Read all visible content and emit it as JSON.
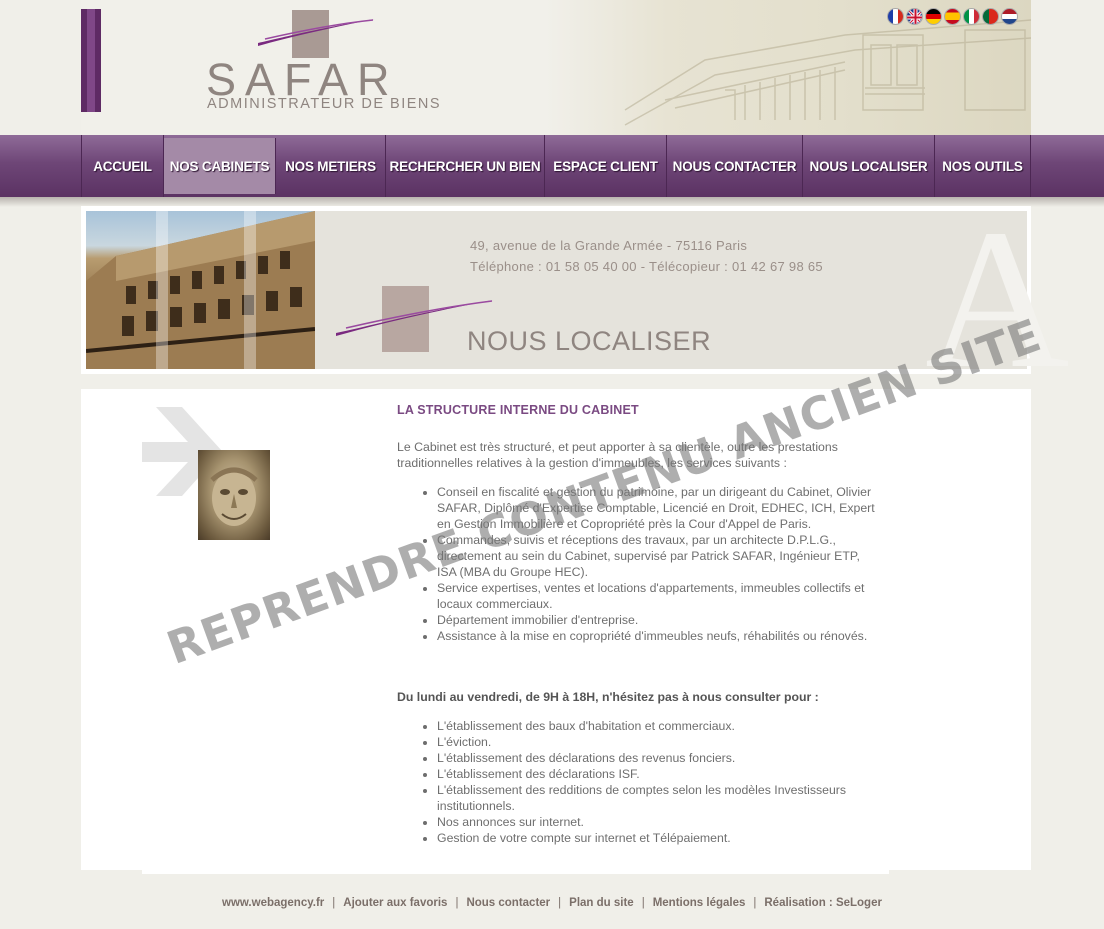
{
  "header": {
    "logo_text": "SAFAR",
    "logo_subtitle": "ADMINISTRATEUR DE BIENS",
    "languages": [
      "fr-flag",
      "en-flag",
      "de-flag",
      "es-flag",
      "it-flag",
      "pt-flag",
      "nl-flag"
    ]
  },
  "nav": {
    "items": [
      {
        "label": "ACCUEIL",
        "active": false
      },
      {
        "label": "NOS CABINETS",
        "active": true
      },
      {
        "label": "NOS METIERS",
        "active": false
      },
      {
        "label": "RECHERCHER UN BIEN",
        "active": false
      },
      {
        "label": "ESPACE CLIENT",
        "active": false
      },
      {
        "label": "NOUS CONTACTER",
        "active": false
      },
      {
        "label": "NOUS LOCALISER",
        "active": false
      },
      {
        "label": "NOS OUTILS",
        "active": false
      }
    ]
  },
  "banner": {
    "address": "49, avenue de la Grande Armée - 75116 Paris",
    "phone": "Téléphone : 01 58 05 40 00 - Télécopieur : 01 42 67 98 65",
    "title": "NOUS LOCALISER"
  },
  "content": {
    "heading": "LA STRUCTURE INTERNE DU CABINET",
    "intro": "Le Cabinet est très structuré, et peut apporter à sa clientèle, outre les prestations traditionnelles relatives à la gestion d'immeubles, les services suivants :",
    "services": [
      "Conseil en fiscalité et gestion du patrimoine, par un dirigeant du Cabinet, Olivier SAFAR, Diplômé d'Expertise Comptable, Licencié en Droit, EDHEC, ICH, Expert en Gestion Immobilière et Copropriété près la Cour d'Appel de Paris.",
      "Commandes, suivis et réceptions des travaux, par un architecte D.P.L.G., directement au sein du Cabinet, supervisé par Patrick SAFAR, Ingénieur ETP, ISA (MBA du Groupe HEC).",
      "Service expertises, ventes et locations d'appartements, immeubles collectifs et locaux commerciaux.",
      "Département immobilier d'entreprise.",
      "Assistance à la mise en copropriété d'immeubles neufs, réhabilités ou rénovés."
    ],
    "hours_heading": "Du lundi au vendredi, de 9H à 18H, n'hésitez pas à nous consulter pour :",
    "consult_items": [
      "L'établissement des baux d'habitation et commerciaux.",
      "L'éviction.",
      "L'établissement des déclarations des revenus fonciers.",
      "L'établissement des déclarations ISF.",
      "L'établissement des redditions de comptes selon les modèles Investisseurs institutionnels.",
      "Nos annonces sur internet.",
      "Gestion de votre compte sur internet et Télépaiement."
    ],
    "watermark": "REPRENDRE CONTENU ANCIEN SITE"
  },
  "footer": {
    "links": [
      "www.webagency.fr",
      "Ajouter aux favoris",
      "Nous contacter",
      "Plan du site",
      "Mentions légales",
      "Réalisation : SeLoger"
    ],
    "separator": "|"
  },
  "colors": {
    "accent_purple": "#6e4677",
    "heading_purple": "#7a4a82",
    "background": "#f0efe9"
  }
}
